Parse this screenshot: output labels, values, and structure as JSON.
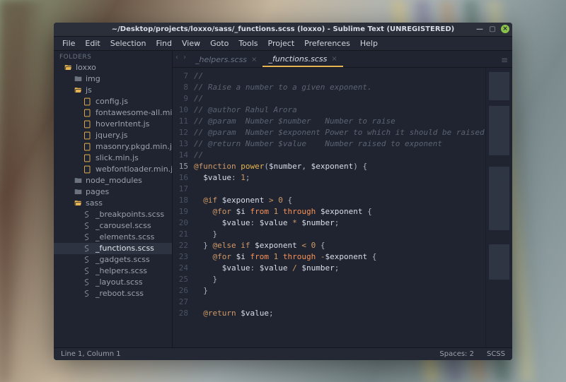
{
  "title": "~/Desktop/projects/loxxo/sass/_functions.scss (loxxo) - Sublime Text (UNREGISTERED)",
  "menu": [
    "File",
    "Edit",
    "Selection",
    "Find",
    "View",
    "Goto",
    "Tools",
    "Project",
    "Preferences",
    "Help"
  ],
  "sidebar": {
    "header": "FOLDERS",
    "items": [
      {
        "depth": 1,
        "icon": "folder-open",
        "label": "loxxo"
      },
      {
        "depth": 2,
        "icon": "folder",
        "label": "img"
      },
      {
        "depth": 2,
        "icon": "folder-open",
        "label": "js"
      },
      {
        "depth": 3,
        "icon": "file-js",
        "label": "config.js"
      },
      {
        "depth": 3,
        "icon": "file-js",
        "label": "fontawesome-all.min.js"
      },
      {
        "depth": 3,
        "icon": "file-js",
        "label": "hoverIntent.js"
      },
      {
        "depth": 3,
        "icon": "file-js",
        "label": "jquery.js"
      },
      {
        "depth": 3,
        "icon": "file-js",
        "label": "masonry.pkgd.min.js"
      },
      {
        "depth": 3,
        "icon": "file-js",
        "label": "slick.min.js"
      },
      {
        "depth": 3,
        "icon": "file-js",
        "label": "webfontloader.min.js"
      },
      {
        "depth": 2,
        "icon": "folder",
        "label": "node_modules"
      },
      {
        "depth": 2,
        "icon": "folder",
        "label": "pages"
      },
      {
        "depth": 2,
        "icon": "folder-open",
        "label": "sass"
      },
      {
        "depth": 3,
        "icon": "file-scss",
        "label": "_breakpoints.scss"
      },
      {
        "depth": 3,
        "icon": "file-scss",
        "label": "_carousel.scss"
      },
      {
        "depth": 3,
        "icon": "file-scss",
        "label": "_elements.scss"
      },
      {
        "depth": 3,
        "icon": "file-scss",
        "label": "_functions.scss",
        "active": true
      },
      {
        "depth": 3,
        "icon": "file-scss",
        "label": "_gadgets.scss"
      },
      {
        "depth": 3,
        "icon": "file-scss",
        "label": "_helpers.scss"
      },
      {
        "depth": 3,
        "icon": "file-scss",
        "label": "_layout.scss"
      },
      {
        "depth": 3,
        "icon": "file-scss",
        "label": "_reboot.scss"
      }
    ]
  },
  "tabs": [
    {
      "label": "_helpers.scss",
      "active": false
    },
    {
      "label": "_functions.scss",
      "active": true
    }
  ],
  "code": {
    "first_line": 7,
    "lines": [
      {
        "n": 7,
        "t": "comment",
        "text": "//"
      },
      {
        "n": 8,
        "t": "comment",
        "text": "// Raise a number to a given exponent."
      },
      {
        "n": 9,
        "t": "comment",
        "text": "//"
      },
      {
        "n": 10,
        "t": "comment",
        "text": "// @author Rahul Arora"
      },
      {
        "n": 11,
        "t": "comment",
        "text": "// @param  Number $number   Number to raise"
      },
      {
        "n": 12,
        "t": "comment",
        "text": "// @param  Number $exponent Power to which it should be raised"
      },
      {
        "n": 13,
        "t": "comment",
        "text": "// @return Number $value    Number raised to exponent"
      },
      {
        "n": 14,
        "t": "comment",
        "text": "//"
      },
      {
        "n": 15,
        "t": "code",
        "hl": true,
        "html": "<span class=c-key>@function</span> <span class=c-func>power</span><span class=c-punc>(</span><span class=c-var>$number</span><span class=c-punc>,</span> <span class=c-var>$exponent</span><span class=c-punc>)</span> <span class=c-punc>{</span>"
      },
      {
        "n": 16,
        "t": "code",
        "html": "  <span class=c-var>$value</span><span class=c-punc>:</span> <span class=c-num>1</span><span class=c-punc>;</span>"
      },
      {
        "n": 17,
        "t": "blank"
      },
      {
        "n": 18,
        "t": "code",
        "html": "  <span class=c-key>@if</span> <span class=c-var>$exponent</span> <span class=c-op>&gt;</span> <span class=c-num>0</span> <span class=c-punc>{</span>"
      },
      {
        "n": 19,
        "t": "code",
        "html": "    <span class=c-key>@for</span> <span class=c-var>$i</span> <span class=c-key2>from</span> <span class=c-num>1</span> <span class=c-key2>through</span> <span class=c-var>$exponent</span> <span class=c-punc>{</span>"
      },
      {
        "n": 20,
        "t": "code",
        "html": "      <span class=c-var>$value</span><span class=c-punc>:</span> <span class=c-var>$value</span> <span class=c-op>*</span> <span class=c-var>$number</span><span class=c-punc>;</span>"
      },
      {
        "n": 21,
        "t": "code",
        "html": "    <span class=c-punc>}</span>"
      },
      {
        "n": 22,
        "t": "code",
        "html": "  <span class=c-punc>}</span> <span class=c-key>@else if</span> <span class=c-var>$exponent</span> <span class=c-op>&lt;</span> <span class=c-num>0</span> <span class=c-punc>{</span>"
      },
      {
        "n": 23,
        "t": "code",
        "html": "    <span class=c-key>@for</span> <span class=c-var>$i</span> <span class=c-key2>from</span> <span class=c-num>1</span> <span class=c-key2>through</span> <span class=c-op>-</span><span class=c-var>$exponent</span> <span class=c-punc>{</span>"
      },
      {
        "n": 24,
        "t": "code",
        "html": "      <span class=c-var>$value</span><span class=c-punc>:</span> <span class=c-var>$value</span> <span class=c-op>/</span> <span class=c-var>$number</span><span class=c-punc>;</span>"
      },
      {
        "n": 25,
        "t": "code",
        "html": "    <span class=c-punc>}</span>"
      },
      {
        "n": 26,
        "t": "code",
        "html": "  <span class=c-punc>}</span>"
      },
      {
        "n": 27,
        "t": "blank"
      },
      {
        "n": 28,
        "t": "code",
        "html": "  <span class=c-key>@return</span> <span class=c-var>$value</span><span class=c-punc>;</span>"
      }
    ]
  },
  "status": {
    "left": "Line 1, Column 1",
    "spaces": "Spaces: 2",
    "syntax": "SCSS"
  }
}
